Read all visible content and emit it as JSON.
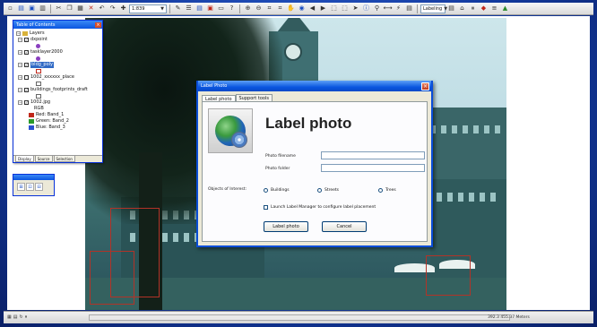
{
  "toolbar": {
    "scale_value": "1:839",
    "layer_combo": "Labeling"
  },
  "toc": {
    "title": "Table of Contents",
    "root_label": "Layers",
    "layers": [
      {
        "label": "dxpoint",
        "symbol_color": "#8a3fbf",
        "symbol": "circle"
      },
      {
        "label": "tasklayer2000",
        "symbol_color": "#8a3fbf",
        "symbol": "circle"
      },
      {
        "label": "bldg_poly",
        "selected": true,
        "symbol_color": "#c0281b",
        "symbol": "square"
      },
      {
        "label": "1002_xxxxxx_place",
        "symbol_color": "#ffffff",
        "symbol": "square"
      },
      {
        "label": "buildings_footprints_draft",
        "symbol_color": "#ffffff",
        "symbol": "square"
      },
      {
        "label": "1002.jpg",
        "symbol_color": "",
        "symbol": ""
      }
    ],
    "raster_label": "RGB",
    "bands": [
      {
        "label": "Red: Band_1",
        "color": "#c0281b"
      },
      {
        "label": "Green: Band_2",
        "color": "#2a9a2a"
      },
      {
        "label": "Blue: Band_3",
        "color": "#2a4fd0"
      }
    ],
    "tabs": [
      "Display",
      "Source",
      "Selection"
    ]
  },
  "dialog": {
    "title": "Label Photo",
    "tabs": [
      "Label photo",
      "Support tools"
    ],
    "heading": "Label photo",
    "photo_filename_label": "Photo filename",
    "photo_folder_label": "Photo folder",
    "photo_filename_value": "",
    "photo_folder_value": "",
    "objects_label": "Objects of Interest:",
    "radio_buildings": "Buildings",
    "radio_streets": "Streets",
    "radio_trees": "Trees",
    "checkbox_label": "Launch Label Manager to configure label placement",
    "ok_button": "Label photo",
    "cancel_button": "Cancel"
  },
  "status": {
    "coordinates": "392.3   455.37 Meters"
  },
  "colors": {
    "frame": "#133a9e",
    "title_bar": "#0a56e0",
    "selection": "#316ac5"
  }
}
